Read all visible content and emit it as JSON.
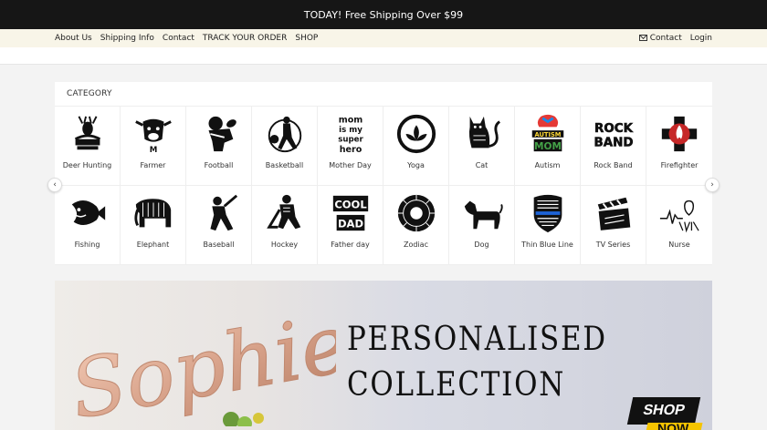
{
  "announcement": "TODAY! Free Shipping Over $99",
  "nav": {
    "left": [
      "About Us",
      "Shipping Info",
      "Contact",
      "TRACK YOUR ORDER",
      "SHOP"
    ],
    "contact": "Contact",
    "login": "Login"
  },
  "category": {
    "title": "CATEGORY",
    "items": [
      {
        "label": "Deer Hunting",
        "icon": "deer-hunting-icon"
      },
      {
        "label": "Farmer",
        "icon": "cow-icon"
      },
      {
        "label": "Football",
        "icon": "football-player-icon"
      },
      {
        "label": "Basketball",
        "icon": "basketball-player-icon"
      },
      {
        "label": "Mother Day",
        "icon": "mom-text-icon"
      },
      {
        "label": "Yoga",
        "icon": "lotus-icon"
      },
      {
        "label": "Cat",
        "icon": "cat-icon"
      },
      {
        "label": "Autism",
        "icon": "autism-mom-icon"
      },
      {
        "label": "Rock Band",
        "icon": "rock-band-icon"
      },
      {
        "label": "Firefighter",
        "icon": "fire-cross-icon"
      },
      {
        "label": "Fishing",
        "icon": "fish-icon"
      },
      {
        "label": "Elephant",
        "icon": "elephant-icon"
      },
      {
        "label": "Baseball",
        "icon": "baseball-player-icon"
      },
      {
        "label": "Hockey",
        "icon": "hockey-player-icon"
      },
      {
        "label": "Father day",
        "icon": "cool-dad-icon"
      },
      {
        "label": "Zodiac",
        "icon": "zodiac-wheel-icon"
      },
      {
        "label": "Dog",
        "icon": "dog-icon"
      },
      {
        "label": "Thin Blue Line",
        "icon": "police-badge-icon"
      },
      {
        "label": "TV Series",
        "icon": "clapperboard-icon"
      },
      {
        "label": "Nurse",
        "icon": "heartbeat-nurse-icon"
      }
    ]
  },
  "banner": {
    "script_text": "Sophie",
    "heading_line1": "PERSONALISED",
    "heading_line2": "COLLECTION",
    "shop_label": "SHOP",
    "now_label": "NOW"
  },
  "colors": {
    "topbar": "#161616",
    "navbar": "#f8f5e8",
    "banner_accent": "#f5c400",
    "rose_gold": "#d9a48c"
  }
}
